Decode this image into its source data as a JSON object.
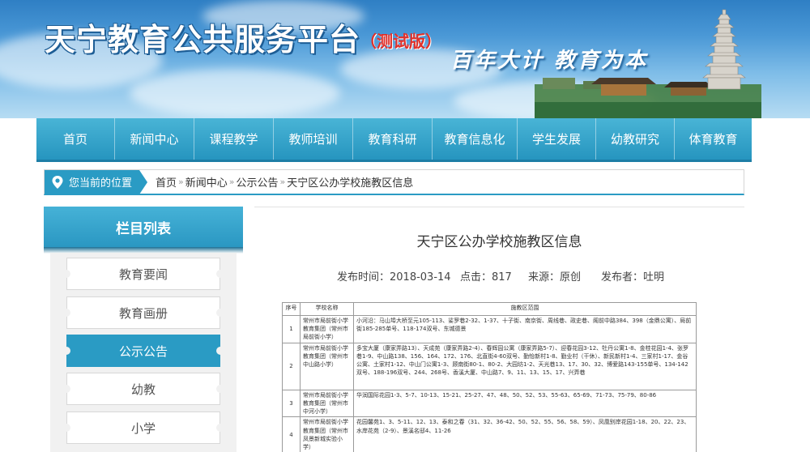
{
  "banner": {
    "title": "天宁教育公共服务平台",
    "beta_tag": "（测试版）",
    "slogan": "百年大计 教育为本"
  },
  "nav": {
    "items": [
      "首页",
      "新闻中心",
      "课程教学",
      "教师培训",
      "教育科研",
      "教育信息化",
      "学生发展",
      "幼教研究",
      "体育教育"
    ]
  },
  "breadcrumb": {
    "label": "您当前的位置",
    "items": [
      "首页",
      "新闻中心",
      "公示公告",
      "天宁区公办学校施教区信息"
    ],
    "separator": "»"
  },
  "sidebar": {
    "title": "栏目列表",
    "items": [
      "教育要闻",
      "教育画册",
      "公示公告",
      "幼教",
      "小学"
    ],
    "active_index": 2
  },
  "article": {
    "title": "天宁区公办学校施教区信息",
    "publish_time": "发布时间：2018-03-14",
    "clicks": "点击：817",
    "source": "来源：原创",
    "publisher": "发布者：吐明"
  },
  "table": {
    "headers": [
      "序号",
      "学校名称",
      "施教区范围"
    ],
    "rows": [
      {
        "no": "1",
        "school": "常州市局前街小学教育集团（常州市局前街小学）",
        "range": "小河沿：马山埠大桥至元105-113、娑罗巷2-32、1-37、十子街、南京街、周线巷、政史巷、阁前中路384、398（金鼎公寓）、局前街185-285单号、118-174双号、东城德景"
      },
      {
        "no": "2",
        "school": "常州市局前街小学教育集团（常州市中山路小学）",
        "range": "多宝大厦（康家弄路13）、天成苑（康家弄路2-4）、春辉园公寓（康家弄路5-7）、迎春花园3-12、牡丹公寓1-8、金桂花园1-4、张罗巷1-9、中山路138、156、164、172、176、北直街4-60双号、勤怡新村1-8、勤业村（干休）、新民新村1-4、三家村1-17、金谷公寓、土家村1-12、中山门公寓1-3、顾南街80-1、80-2、大园坊1-2、天光巷13、17、30、32、博爱路143-155单号、134-142双号、188-196双号、244、268号、香溪大厦、中山路7、9、11、13、15、17、兴弄巷"
      },
      {
        "no": "3",
        "school": "常州市局前街小学教育集团（常州市中河小学）",
        "range": "华润国际花园1-3、5-7、10-13、15-21、25-27、47、48、50、52、53、55-63、65-69、71-73、75-79、80-86"
      },
      {
        "no": "4",
        "school": "常州市局前街小学教育集团（常州市凤景新城实验小学）",
        "range": "花园馨苑1、3、5-11、12、13、泰和之春（31、32、36-42、50、52、55、56、58、59）、凤凰别岸花园1-18、20、22、23、水岸花苑（2-9）、景溪名邸4、11-26"
      }
    ]
  },
  "colors": {
    "nav_blue": "#2a9bc4",
    "banner_sky": "#4a98d6",
    "beta_red": "#e0302a"
  }
}
